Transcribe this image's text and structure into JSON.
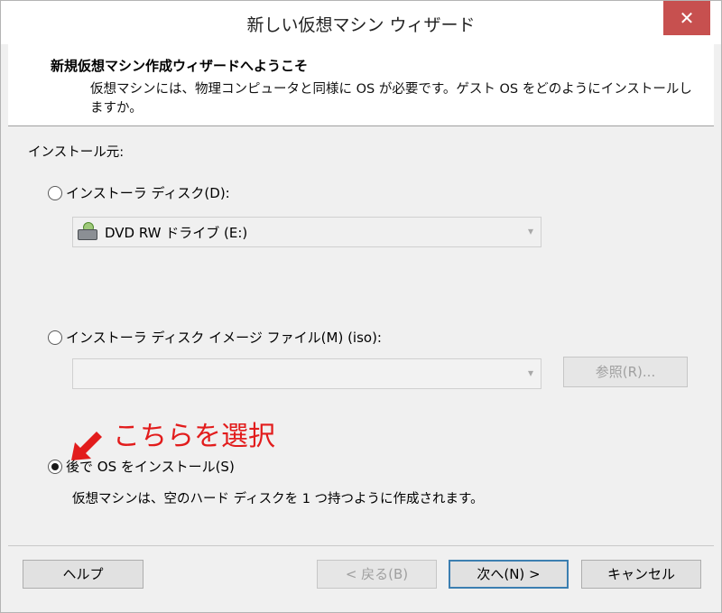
{
  "window": {
    "title": "新しい仮想マシン ウィザード",
    "close_label": "✕"
  },
  "header": {
    "title": "新規仮想マシン作成ウィザードへようこそ",
    "description": "仮想マシンには、物理コンピュータと同様に OS が必要です。ゲスト OS をどのようにインストールしますか。"
  },
  "install_source": {
    "label": "インストール元:",
    "options": [
      {
        "label": "インストーラ ディスク(D):",
        "selected": false
      },
      {
        "label": "インストーラ ディスク イメージ ファイル(M) (iso):",
        "selected": false
      },
      {
        "label": "後で OS をインストール(S)",
        "selected": true
      }
    ],
    "disc_drive_value": "DVD RW ドライブ (E:)",
    "iso_path_value": "",
    "browse_label": "参照(R)...",
    "later_description": "仮想マシンは、空のハード ディスクを 1 つ持つように作成されます。"
  },
  "annotation": {
    "text": "こちらを選択",
    "color": "#e21c1c"
  },
  "footer": {
    "help_label": "ヘルプ",
    "back_label": "< 戻る(B)",
    "next_label": "次へ(N) >",
    "cancel_label": "キャンセル"
  }
}
